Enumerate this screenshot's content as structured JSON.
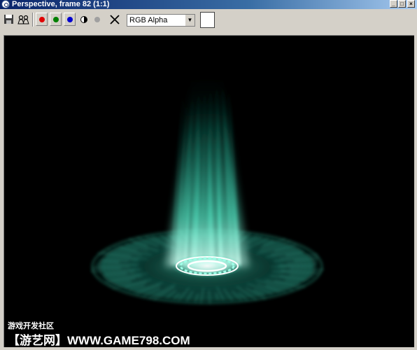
{
  "window": {
    "title": "Perspective, frame 82 (1:1)",
    "controls": {
      "minimize": "_",
      "maximize": "□",
      "close": "×"
    }
  },
  "toolbar": {
    "icons": [
      "save-icon",
      "clone-icon",
      "red-channel-icon",
      "green-channel-icon",
      "blue-channel-icon",
      "mono-icon",
      "alpha-icon",
      "clear-icon"
    ],
    "channel_select": "RGB Alpha",
    "colors": {
      "red": "#e00000",
      "green": "#008000",
      "blue": "#0000d0"
    }
  },
  "render": {
    "background": "#000000",
    "effect_color": "#4fe8c8"
  },
  "watermark": {
    "line1": "游戏开发社区",
    "line2": "【游艺网】WWW.GAME798.COM"
  }
}
